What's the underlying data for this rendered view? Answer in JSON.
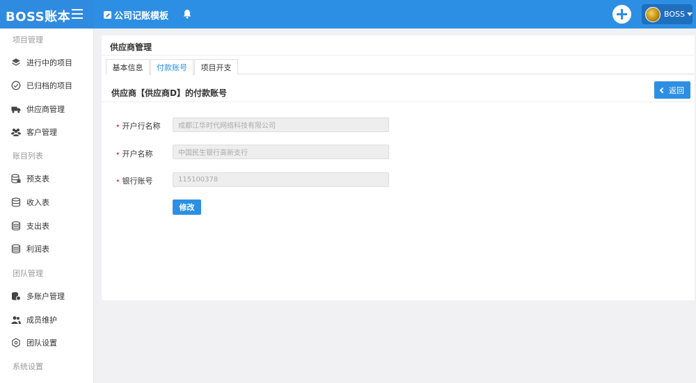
{
  "header": {
    "brand": "BOSS账本",
    "template_link": "公司记账模板",
    "user_name": "BOSS"
  },
  "sidebar": {
    "sections": [
      {
        "label": "项目管理"
      },
      {
        "label": "账目列表"
      },
      {
        "label": "团队管理"
      },
      {
        "label": "系统设置"
      }
    ],
    "items": [
      {
        "label": "进行中的项目",
        "icon": "layers-icon"
      },
      {
        "label": "已归档的项目",
        "icon": "check-circle-icon"
      },
      {
        "label": "供应商管理",
        "icon": "truck-icon"
      },
      {
        "label": "客户管理",
        "icon": "users-icon"
      },
      {
        "label": "预支表",
        "icon": "database-icon"
      },
      {
        "label": "收入表",
        "icon": "database-icon"
      },
      {
        "label": "支出表",
        "icon": "database-icon"
      },
      {
        "label": "利润表",
        "icon": "database-icon"
      },
      {
        "label": "多账户管理",
        "icon": "account-coins-icon"
      },
      {
        "label": "成员维护",
        "icon": "members-icon"
      },
      {
        "label": "团队设置",
        "icon": "settings-hexagon-icon"
      }
    ]
  },
  "main": {
    "title": "供应商管理",
    "tabs": [
      {
        "label": "基本信息",
        "active": false
      },
      {
        "label": "付款账号",
        "active": true
      },
      {
        "label": "项目开支",
        "active": false
      }
    ],
    "subtitle": "供应商【供应商D】的付款账号",
    "back_label": "返回",
    "form": {
      "bank_name": {
        "label": "开户行名称",
        "value": "成都江华时代网络科技有限公司"
      },
      "account_name": {
        "label": "开户名称",
        "value": "中国民生银行高新支行"
      },
      "account_number": {
        "label": "银行账号",
        "value": "115100378"
      }
    },
    "edit_label": "修改"
  },
  "colors": {
    "primary": "#2d8fe3",
    "required": "#e44444"
  }
}
